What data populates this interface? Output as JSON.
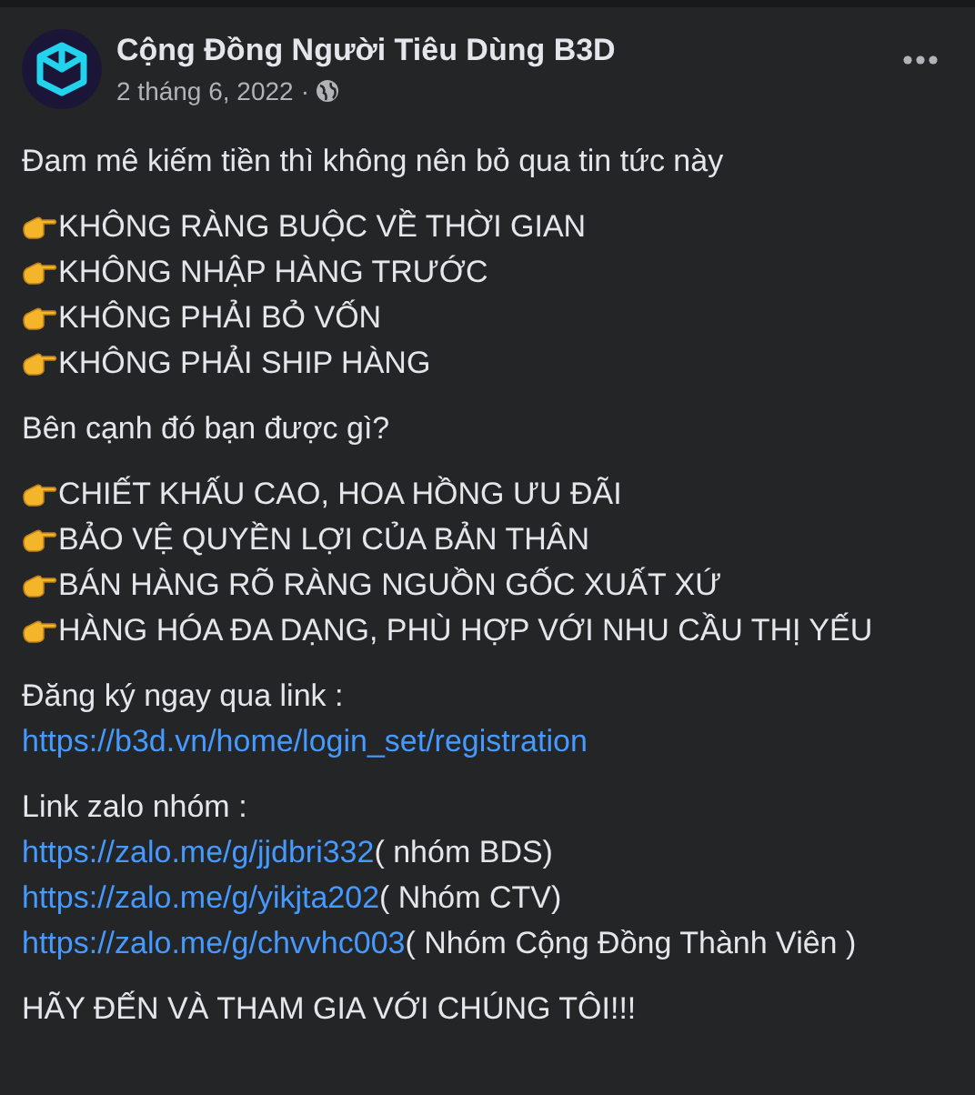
{
  "post": {
    "author": "Cộng Đồng Người Tiêu Dùng B3D",
    "date": "2 tháng 6, 2022",
    "separator": "·"
  },
  "body": [
    {
      "kind": "paragraph",
      "text": "Đam mê kiếm tiền thì không nên bỏ qua tin tức này"
    },
    {
      "kind": "bullets",
      "items": [
        "KHÔNG RÀNG BUỘC VỀ THỜI GIAN",
        "KHÔNG NHẬP HÀNG TRƯỚC",
        "KHÔNG PHẢI BỎ VỐN",
        "KHÔNG PHẢI SHIP HÀNG"
      ]
    },
    {
      "kind": "paragraph",
      "text": "Bên cạnh đó bạn được gì?"
    },
    {
      "kind": "bullets",
      "items": [
        "CHIẾT KHẤU CAO, HOA HỒNG ƯU ĐÃI",
        "BẢO VỆ QUYỀN LỢI CỦA BẢN THÂN",
        "BÁN HÀNG RÕ RÀNG NGUỒN GỐC XUẤT XỨ",
        "HÀNG HÓA ĐA DẠNG, PHÙ HỢP VỚI NHU CẦU THỊ YẾU"
      ]
    },
    {
      "kind": "links",
      "title": "Đăng ký ngay qua link :",
      "links": [
        {
          "url": "https://b3d.vn/home/login_set/registration"
        }
      ]
    },
    {
      "kind": "links",
      "title": "Link zalo nhóm :",
      "links": [
        {
          "url": "https://zalo.me/g/jjdbri332",
          "note": "( nhóm BDS)"
        },
        {
          "url": "https://zalo.me/g/yikjta202",
          "note": "( Nhóm CTV)"
        },
        {
          "url": "https://zalo.me/g/chvvhc003",
          "note": "( Nhóm Cộng Đồng Thành Viên )"
        }
      ]
    },
    {
      "kind": "paragraph",
      "text": "HÃY ĐẾN VÀ THAM GIA VỚI CHÚNG TÔI!!!"
    }
  ]
}
